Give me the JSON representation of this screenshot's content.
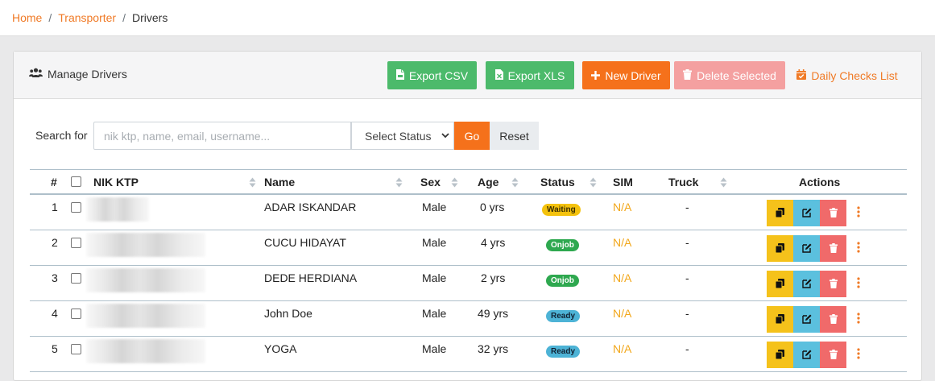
{
  "breadcrumb": {
    "items": [
      {
        "label": "Home"
      },
      {
        "label": "Transporter"
      }
    ],
    "separator": "/",
    "current": "Drivers"
  },
  "card": {
    "title": "Manage Drivers",
    "buttons": {
      "export_csv": "Export CSV",
      "export_xls": "Export XLS",
      "new_driver": "New Driver",
      "delete_selected": "Delete Selected",
      "daily_checks": "Daily Checks List"
    }
  },
  "search": {
    "label": "Search for",
    "placeholder": "nik ktp, name, email, username...",
    "status_selected": "Select Status",
    "go_label": "Go",
    "reset_label": "Reset"
  },
  "table": {
    "headers": {
      "index": "#",
      "nik": "NIK KTP",
      "name": "Name",
      "sex": "Sex",
      "age": "Age",
      "status": "Status",
      "sim": "SIM",
      "truck": "Truck",
      "actions": "Actions"
    },
    "rows": [
      {
        "index": "1",
        "name": "ADAR ISKANDAR",
        "sex": "Male",
        "age": "0 yrs",
        "status": "Waiting",
        "sim": "N/A",
        "truck": "-"
      },
      {
        "index": "2",
        "name": "CUCU HIDAYAT",
        "sex": "Male",
        "age": "4 yrs",
        "status": "Onjob",
        "sim": "N/A",
        "truck": "-"
      },
      {
        "index": "3",
        "name": "DEDE HERDIANA",
        "sex": "Male",
        "age": "2 yrs",
        "status": "Onjob",
        "sim": "N/A",
        "truck": "-"
      },
      {
        "index": "4",
        "name": "John Doe",
        "sex": "Male",
        "age": "49 yrs",
        "status": "Ready",
        "sim": "N/A",
        "truck": "-"
      },
      {
        "index": "5",
        "name": "YOGA",
        "sex": "Male",
        "age": "32 yrs",
        "status": "Ready",
        "sim": "N/A",
        "truck": "-"
      }
    ]
  },
  "colors": {
    "accent": "#f5711b",
    "success": "#4cba6b",
    "danger_light": "#f4a0a0",
    "warning": "#f5c21b",
    "info": "#5bc0de",
    "danger": "#f06a6a"
  },
  "icons": {
    "title": "users-icon",
    "export_csv": "file-csv-icon",
    "export_xls": "file-excel-icon",
    "new_driver": "plus-icon",
    "delete_selected": "trash-icon",
    "daily_checks": "calendar-check-icon",
    "row_actions": [
      "copy-icon",
      "edit-icon",
      "trash-icon",
      "more-vertical-icon"
    ]
  }
}
